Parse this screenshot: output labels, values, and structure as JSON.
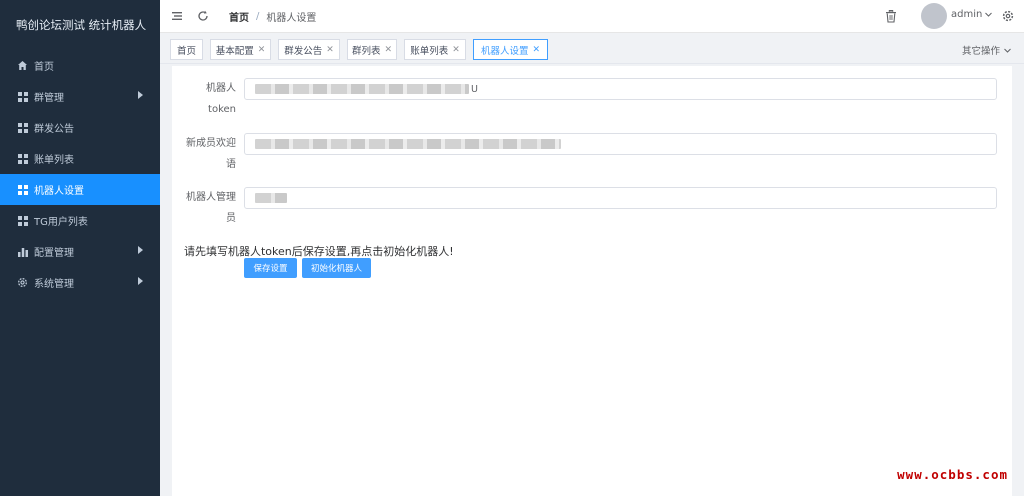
{
  "sidebar": {
    "brand": "鸭创论坛测试 统计机器人",
    "items": [
      {
        "label": "首页",
        "icon": "home-icon"
      },
      {
        "label": "群管理",
        "icon": "grid-icon"
      },
      {
        "label": "群发公告",
        "icon": "grid-icon"
      },
      {
        "label": "账单列表",
        "icon": "grid-icon"
      },
      {
        "label": "机器人设置",
        "icon": "grid-icon"
      },
      {
        "label": "TG用户列表",
        "icon": "grid-icon"
      },
      {
        "label": "配置管理",
        "icon": "bar-chart-icon"
      },
      {
        "label": "系统管理",
        "icon": "gear-icon"
      }
    ]
  },
  "header": {
    "breadcrumb_home": "首页",
    "breadcrumb_sep": "/",
    "breadcrumb_current": "机器人设置",
    "username": "admin"
  },
  "tags": {
    "items": [
      {
        "label": "首页"
      },
      {
        "label": "基本配置"
      },
      {
        "label": "群发公告"
      },
      {
        "label": "群列表"
      },
      {
        "label": "账单列表"
      },
      {
        "label": "机器人设置"
      }
    ],
    "other_ops": "其它操作"
  },
  "form": {
    "token_label_1": "机器人",
    "token_label_2": "token",
    "token_suffix": "U",
    "welcome_label_1": "新成员欢迎",
    "welcome_label_2": "语",
    "admin_label_1": "机器人管理",
    "admin_label_2": "员",
    "hint": "请先填写机器人token后保存设置,再点击初始化机器人!",
    "save_button": "保存设置",
    "init_button": "初始化机器人"
  },
  "watermark": "www.ocbbs.com",
  "colors": {
    "sidebar_bg": "#1f2d3d",
    "active_menu": "#1890ff",
    "primary_button": "#409eff",
    "watermark": "#c00000"
  }
}
